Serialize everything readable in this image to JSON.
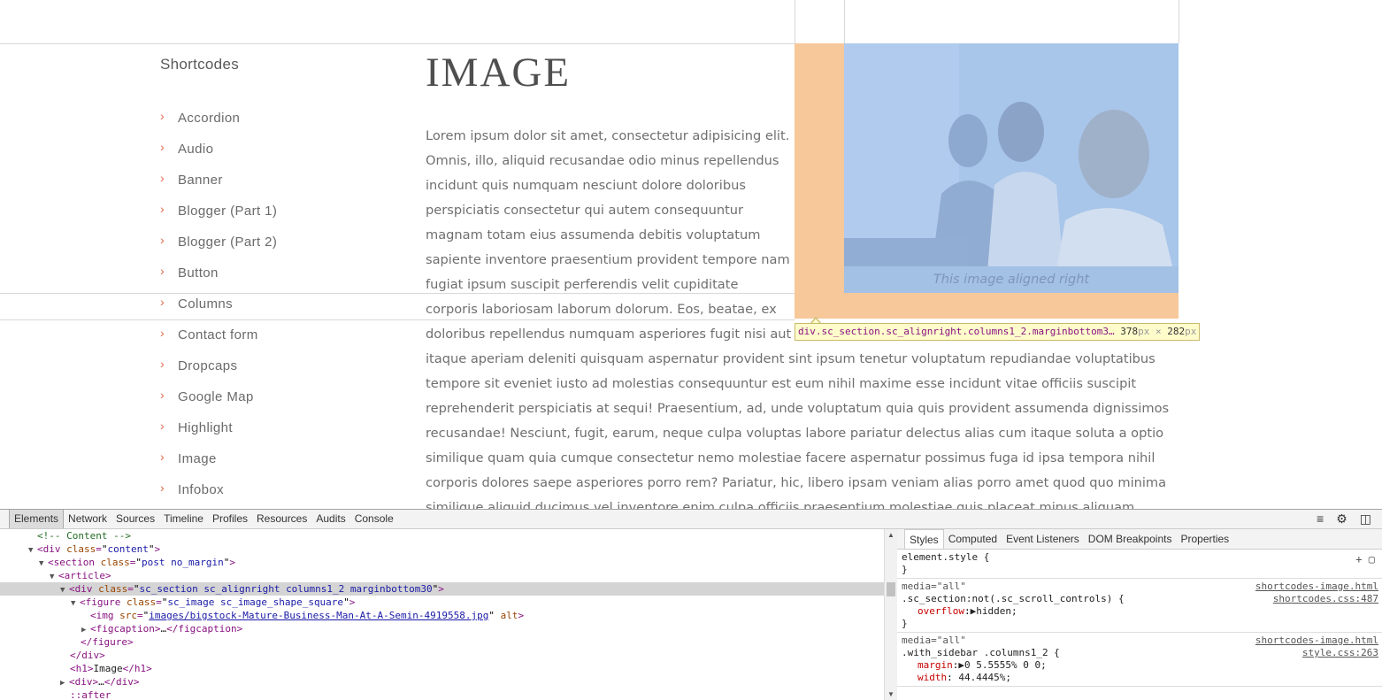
{
  "page": {
    "sidebar_title": "Shortcodes",
    "sidebar_items": [
      "Accordion",
      "Audio",
      "Banner",
      "Blogger (Part 1)",
      "Blogger (Part 2)",
      "Button",
      "Columns",
      "Contact form",
      "Dropcaps",
      "Google Map",
      "Highlight",
      "Image",
      "Infobox"
    ],
    "post_title": "IMAGE",
    "paragraph_lines": [
      "Lorem ipsum dolor sit amet, consectetur adipisicing elit.",
      "Omnis, illo, aliquid recusandae odio minus repellendus",
      "incidunt quis numquam nesciunt dolore doloribus",
      "perspiciatis consectetur qui autem consequuntur",
      "magnam totam eius assumenda debitis voluptatum",
      "sapiente inventore praesentium provident tempore nam",
      "fugiat ipsum suscipit perferendis velit cupiditate",
      "corporis laboriosam laborum dolorum. Eos, beatae, ex",
      "doloribus repellendus numquam asperiores fugit nisi aut",
      "itaque aperiam deleniti quisquam aspernatur provident sint ipsum tenetur voluptatum repudiandae voluptatibus",
      "tempore sit eveniet iusto ad molestias consequuntur est eum nihil maxime esse incidunt vitae officiis suscipit",
      "reprehenderit perspiciatis at sequi! Praesentium, ad, unde voluptatum quia quis provident assumenda dignissimos",
      "recusandae! Nesciunt, fugit, earum, neque culpa voluptas labore pariatur delectus alias cum itaque soluta a optio",
      "similique quam quia cumque consectetur nemo molestiae facere aspernatur possimus fuga id ipsa tempora nihil",
      "corporis dolores saepe asperiores porro rem? Pariatur, hic, libero ipsam veniam alias porro amet quod quo minima",
      "similique aliquid ducimus vel inventore enim culpa officiis praesentium molestiae quis placeat minus aliquam"
    ],
    "image_caption": "This image aligned right",
    "tooltip": {
      "selector": "div.sc_section.sc_alignright.columns1_2.marginbottom3…",
      "width": "378",
      "height": "282",
      "unit": "px",
      "times": "×"
    }
  },
  "devtools": {
    "tabs": [
      "Elements",
      "Network",
      "Sources",
      "Timeline",
      "Profiles",
      "Resources",
      "Audits",
      "Console"
    ],
    "active_tab": "Elements",
    "icons": [
      "execute-icon",
      "gear-icon",
      "dock-icon"
    ],
    "dom": {
      "comment": "<!-- Content -->",
      "content_tag": "div",
      "content_attr": "class",
      "content_val": "content",
      "section_tag": "section",
      "section_attr": "class",
      "section_val": "post no_margin",
      "article_tag": "article",
      "sc_tag": "div",
      "sc_attr": "class",
      "sc_val": "sc_section sc_alignright columns1_2 marginbottom30",
      "figure_tag": "figure",
      "figure_attr": "class",
      "figure_val": "sc_image sc_image_shape_square",
      "img_tag": "img",
      "img_attr": "src",
      "img_val": "images/bigstock-Mature-Business-Man-At-A-Semin-4919558.jpg",
      "img_alt": "alt",
      "figcaption_open": "<figcaption>",
      "figcaption_ellipsis": "…",
      "figcaption_close": "</figcaption>",
      "figure_close": "</figure>",
      "div_close": "</div>",
      "h1_open": "<h1>",
      "h1_text": "Image",
      "h1_close": "</h1>",
      "div_open": "<div>",
      "div_ellipsis": "…",
      "div_close2": "</div>",
      "after": "::after"
    },
    "styles_tabs": [
      "Styles",
      "Computed",
      "Event Listeners",
      "DOM Breakpoints",
      "Properties"
    ],
    "active_styles_tab": "Styles",
    "rules": [
      {
        "selector": "element.style {",
        "close": "}"
      },
      {
        "media": "media=\"all\"",
        "source1": "shortcodes-image.html",
        "selector": ".sc_section:not(.sc_scroll_controls) {",
        "source2": "shortcodes.css:487",
        "prop": "overflow",
        "value": "hidden;",
        "close": "}"
      },
      {
        "media": "media=\"all\"",
        "source1": "shortcodes-image.html",
        "selector": ".with_sidebar .columns1_2 {",
        "source2": "style.css:263",
        "prop1": "margin",
        "value1": "0 5.5555% 0 0;",
        "prop2": "width",
        "value2": "44.4445%;"
      }
    ]
  }
}
